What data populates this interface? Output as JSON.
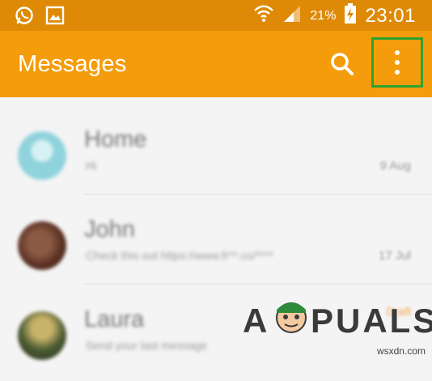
{
  "status_bar": {
    "left_icons": [
      "whatsapp-icon",
      "gallery-icon"
    ],
    "battery_percent": "21%",
    "time": "23:01"
  },
  "app_bar": {
    "title": "Messages",
    "search_icon": "search-icon",
    "more_icon": "more-vertical-icon",
    "highlight_color": "#2fa32f"
  },
  "conversations": [
    {
      "name": "Home",
      "snippet": "Hi",
      "date": "9 Aug",
      "avatar_color": "#8fd3dc"
    },
    {
      "name": "John",
      "snippet": "Check this out https://www.fr**.co/****",
      "date": "17 Jul",
      "avatar_color": "#6b3c2c"
    },
    {
      "name": "Laura",
      "snippet": "Send your last message",
      "date": "",
      "badge": "Draft",
      "avatar_color": "#4a5a33"
    }
  ],
  "colors": {
    "status_bar": "#de8a06",
    "app_bar": "#f49c0b",
    "background": "#f4f4f4"
  },
  "watermark": {
    "logo_text": "APPUALS",
    "site": "wsxdn.com"
  }
}
